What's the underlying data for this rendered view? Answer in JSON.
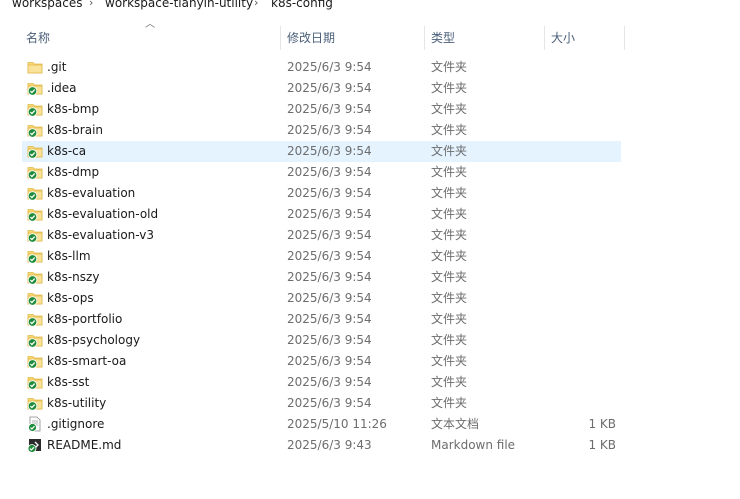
{
  "breadcrumb": [
    "workspaces",
    "workspace-tianyin-utility",
    "k8s-config"
  ],
  "columns": {
    "name": "名称",
    "date": "修改日期",
    "type": "类型",
    "size": "大小"
  },
  "files": [
    {
      "name": ".git",
      "date": "2025/6/3 9:54",
      "type": "文件夹",
      "size": "",
      "icon": "folder-icon"
    },
    {
      "name": ".idea",
      "date": "2025/6/3 9:54",
      "type": "文件夹",
      "size": "",
      "icon": "folder-synced-icon"
    },
    {
      "name": "k8s-bmp",
      "date": "2025/6/3 9:54",
      "type": "文件夹",
      "size": "",
      "icon": "folder-synced-icon"
    },
    {
      "name": "k8s-brain",
      "date": "2025/6/3 9:54",
      "type": "文件夹",
      "size": "",
      "icon": "folder-synced-icon"
    },
    {
      "name": "k8s-ca",
      "date": "2025/6/3 9:54",
      "type": "文件夹",
      "size": "",
      "icon": "folder-synced-icon",
      "selected": true
    },
    {
      "name": "k8s-dmp",
      "date": "2025/6/3 9:54",
      "type": "文件夹",
      "size": "",
      "icon": "folder-synced-icon"
    },
    {
      "name": "k8s-evaluation",
      "date": "2025/6/3 9:54",
      "type": "文件夹",
      "size": "",
      "icon": "folder-synced-icon"
    },
    {
      "name": "k8s-evaluation-old",
      "date": "2025/6/3 9:54",
      "type": "文件夹",
      "size": "",
      "icon": "folder-synced-icon"
    },
    {
      "name": "k8s-evaluation-v3",
      "date": "2025/6/3 9:54",
      "type": "文件夹",
      "size": "",
      "icon": "folder-synced-icon"
    },
    {
      "name": "k8s-llm",
      "date": "2025/6/3 9:54",
      "type": "文件夹",
      "size": "",
      "icon": "folder-synced-icon"
    },
    {
      "name": "k8s-nszy",
      "date": "2025/6/3 9:54",
      "type": "文件夹",
      "size": "",
      "icon": "folder-synced-icon"
    },
    {
      "name": "k8s-ops",
      "date": "2025/6/3 9:54",
      "type": "文件夹",
      "size": "",
      "icon": "folder-synced-icon"
    },
    {
      "name": "k8s-portfolio",
      "date": "2025/6/3 9:54",
      "type": "文件夹",
      "size": "",
      "icon": "folder-synced-icon"
    },
    {
      "name": "k8s-psychology",
      "date": "2025/6/3 9:54",
      "type": "文件夹",
      "size": "",
      "icon": "folder-synced-icon"
    },
    {
      "name": "k8s-smart-oa",
      "date": "2025/6/3 9:54",
      "type": "文件夹",
      "size": "",
      "icon": "folder-synced-icon"
    },
    {
      "name": "k8s-sst",
      "date": "2025/6/3 9:54",
      "type": "文件夹",
      "size": "",
      "icon": "folder-synced-icon"
    },
    {
      "name": "k8s-utility",
      "date": "2025/6/3 9:54",
      "type": "文件夹",
      "size": "",
      "icon": "folder-synced-icon"
    },
    {
      "name": ".gitignore",
      "date": "2025/5/10 11:26",
      "type": "文本文档",
      "size": "1 KB",
      "icon": "text-file-synced-icon"
    },
    {
      "name": "README.md",
      "date": "2025/6/3 9:43",
      "type": "Markdown file",
      "size": "1 KB",
      "icon": "markdown-file-synced-icon"
    }
  ],
  "colors": {
    "selected_row": "#e5f3ff",
    "folder": "#f8d775",
    "sync_check": "#1e8c3a",
    "header_text": "#4c607a"
  }
}
